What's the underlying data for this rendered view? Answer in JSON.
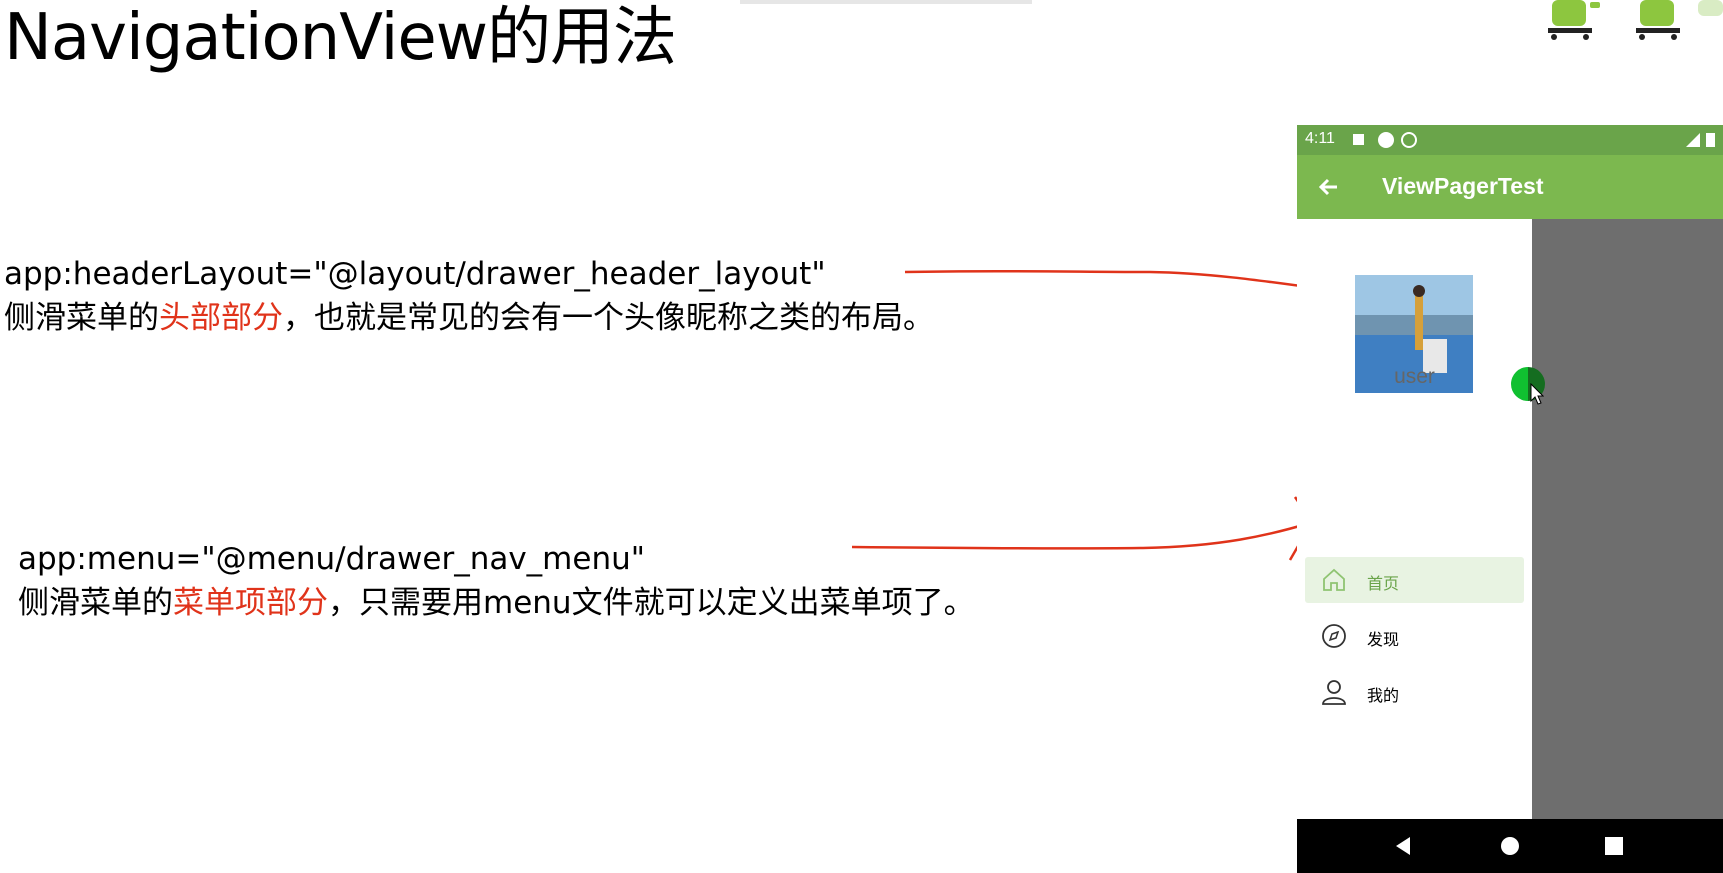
{
  "slide": {
    "title": "NavigationView的用法"
  },
  "notes": [
    {
      "code": "app:headerLayout=\"@layout/drawer_header_layout\"",
      "prefix": "侧滑菜单的",
      "highlight": "头部部分",
      "suffix": "，也就是常见的会有一个头像昵称之类的布局。"
    },
    {
      "code": "app:menu=\"@menu/drawer_nav_menu\"",
      "prefix": "侧滑菜单的",
      "highlight": "菜单项部分",
      "suffix": "，只需要用menu文件就可以定义出菜单项了。"
    }
  ],
  "phone": {
    "status_time": "4:11",
    "app_title": "ViewPagerTest",
    "username": "user",
    "menu_items": [
      {
        "label": "首页",
        "icon": "home-icon",
        "selected": true
      },
      {
        "label": "发现",
        "icon": "compass-icon",
        "selected": false
      },
      {
        "label": "我的",
        "icon": "person-icon",
        "selected": false
      }
    ]
  },
  "colors": {
    "status_bar": "#6aa44a",
    "app_bar": "#7cb84f",
    "highlight_text": "#e0331a",
    "arrow": "#e0331a",
    "scrim": "#6e6e6e"
  }
}
